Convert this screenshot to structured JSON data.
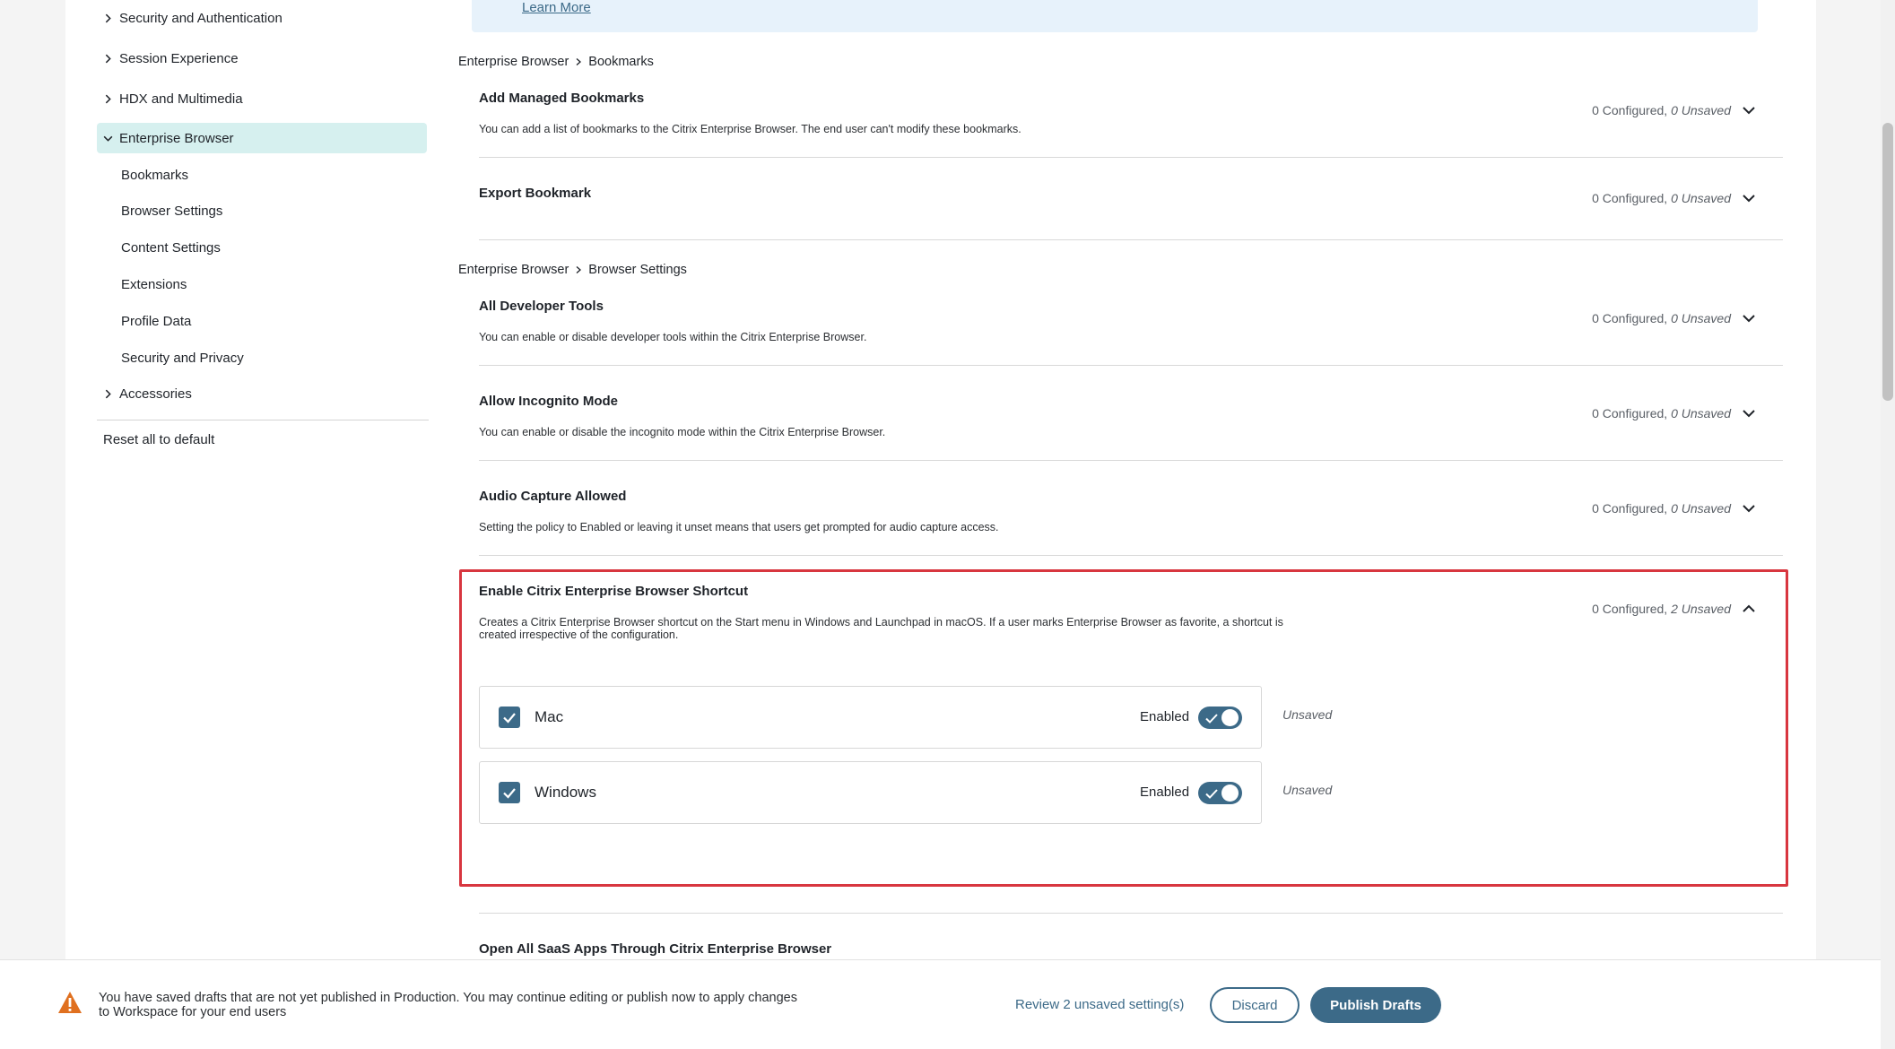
{
  "sidebar": {
    "groups": [
      {
        "label": "Security and Authentication"
      },
      {
        "label": "Session Experience"
      },
      {
        "label": "HDX and Multimedia"
      },
      {
        "label": "Enterprise Browser"
      }
    ],
    "sub_items": [
      {
        "label": "Bookmarks"
      },
      {
        "label": "Browser Settings"
      },
      {
        "label": "Content Settings"
      },
      {
        "label": "Extensions"
      },
      {
        "label": "Profile Data"
      },
      {
        "label": "Security and Privacy"
      }
    ],
    "accessories": "Accessories",
    "reset": "Reset all to default"
  },
  "banner": {
    "learn_more": "Learn More"
  },
  "sections": [
    {
      "parent": "Enterprise Browser",
      "child": "Bookmarks"
    },
    {
      "parent": "Enterprise Browser",
      "child": "Browser Settings"
    }
  ],
  "settings": [
    {
      "title": "Add Managed Bookmarks",
      "desc": "You can add a list of bookmarks to the Citrix Enterprise Browser. The end user can't modify these bookmarks.",
      "configured": "0 Configured,",
      "unsaved": "0 Unsaved"
    },
    {
      "title": "Export Bookmark",
      "desc": "",
      "configured": "0 Configured,",
      "unsaved": "0 Unsaved"
    },
    {
      "title": "All Developer Tools",
      "desc": "You can enable or disable developer tools within the Citrix Enterprise Browser.",
      "configured": "0 Configured,",
      "unsaved": "0 Unsaved"
    },
    {
      "title": "Allow Incognito Mode",
      "desc": "You can enable or disable the incognito mode within the Citrix Enterprise Browser.",
      "configured": "0 Configured,",
      "unsaved": "0 Unsaved"
    },
    {
      "title": "Audio Capture Allowed",
      "desc": "Setting the policy to Enabled or leaving it unset means that users get prompted for audio capture access.",
      "configured": "0 Configured,",
      "unsaved": "0 Unsaved"
    },
    {
      "title": "Enable Citrix Enterprise Browser Shortcut",
      "desc_line1": "Creates a Citrix Enterprise Browser shortcut on the Start menu in Windows and Launchpad in macOS. If a user marks Enterprise Browser as favorite, a shortcut is",
      "desc_line2": "created irrespective of the configuration.",
      "configured": "0 Configured,",
      "unsaved": "2 Unsaved"
    },
    {
      "title": "Open All SaaS Apps Through Citrix Enterprise Browser"
    }
  ],
  "platforms": [
    {
      "name": "Mac",
      "state_label": "Enabled",
      "checked": true,
      "enabled": true,
      "status": "Unsaved"
    },
    {
      "name": "Windows",
      "state_label": "Enabled",
      "checked": true,
      "enabled": true,
      "status": "Unsaved"
    }
  ],
  "bottom_bar": {
    "warning_line1": "You have saved drafts that are not yet published in Production. You may continue editing or publish now to apply changes",
    "warning_line2": "to Workspace for your end users",
    "review": "Review 2 unsaved setting(s)",
    "discard": "Discard",
    "publish": "Publish Drafts"
  },
  "colors": {
    "accent": "#3c6a88",
    "active_nav": "#d6f0ef",
    "highlight_border": "#d8363f",
    "warning": "#e0701f",
    "banner_bg": "#e7f2fb"
  },
  "icons": {
    "nav_collapsed": "chevron-right-icon",
    "nav_expanded": "chevron-down-icon",
    "setting_collapsed": "chevron-down-icon",
    "setting_expanded": "chevron-up-icon",
    "checkbox": "check-icon",
    "warning": "warning-triangle-icon"
  }
}
